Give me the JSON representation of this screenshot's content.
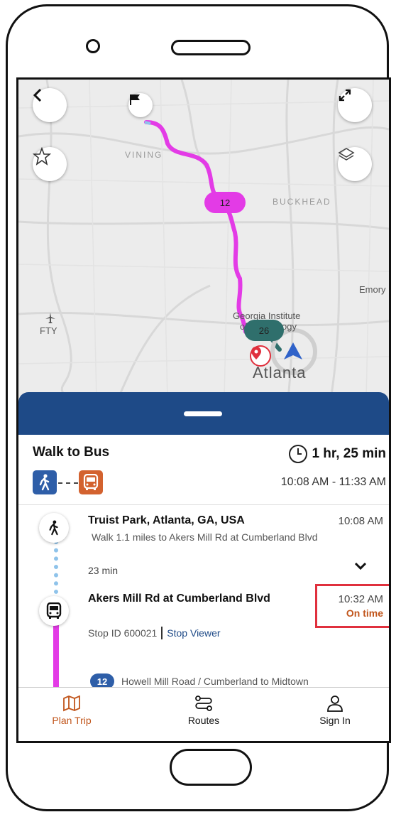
{
  "colors": {
    "primary_blue": "#1e4a87",
    "route_magenta": "#e33be6",
    "bus_teal": "#2f6f6c",
    "accent_orange": "#c1551b",
    "highlight_red": "#e0303d"
  },
  "map": {
    "labels": {
      "vinings": "VINING",
      "buckhead": "BUCKHEAD",
      "emory": "Emory",
      "fty": "FTY",
      "georgia_tech_1": "Georgia Institute",
      "georgia_tech_2": "of Technology",
      "atlanta": "Atlanta"
    },
    "route_bubbles": {
      "walk_route": "12",
      "bus_route": "26"
    },
    "icons": [
      "back-icon",
      "flag-icon",
      "expand-icon",
      "favorite-icon",
      "layers-icon",
      "location-pin-icon",
      "navigation-arrow-icon",
      "airport-icon"
    ]
  },
  "trip": {
    "title": "Walk to Bus",
    "duration": "1 hr, 25 min",
    "time_range": "10:08 AM - 11:33 AM",
    "modes": [
      "walk-icon",
      "bus-icon"
    ],
    "legs": [
      {
        "name": "Truist Park, Atlanta, GA, USA",
        "time": "10:08 AM",
        "description": "Walk 1.1 miles to Akers Mill Rd at Cumberland Blvd",
        "duration": "23 min"
      },
      {
        "name": "Akers Mill Rd at Cumberland Blvd",
        "time": "10:32 AM",
        "status": "On time",
        "stop_id": "Stop ID 600021",
        "stop_viewer": "Stop Viewer",
        "route_number": "12",
        "route_name": "Howell Mill Road / Cumberland to Midtown"
      }
    ]
  },
  "nav": {
    "items": [
      {
        "label": "Plan Trip",
        "icon": "map-icon",
        "active": true
      },
      {
        "label": "Routes",
        "icon": "routes-icon",
        "active": false
      },
      {
        "label": "Sign In",
        "icon": "user-icon",
        "active": false
      }
    ]
  }
}
